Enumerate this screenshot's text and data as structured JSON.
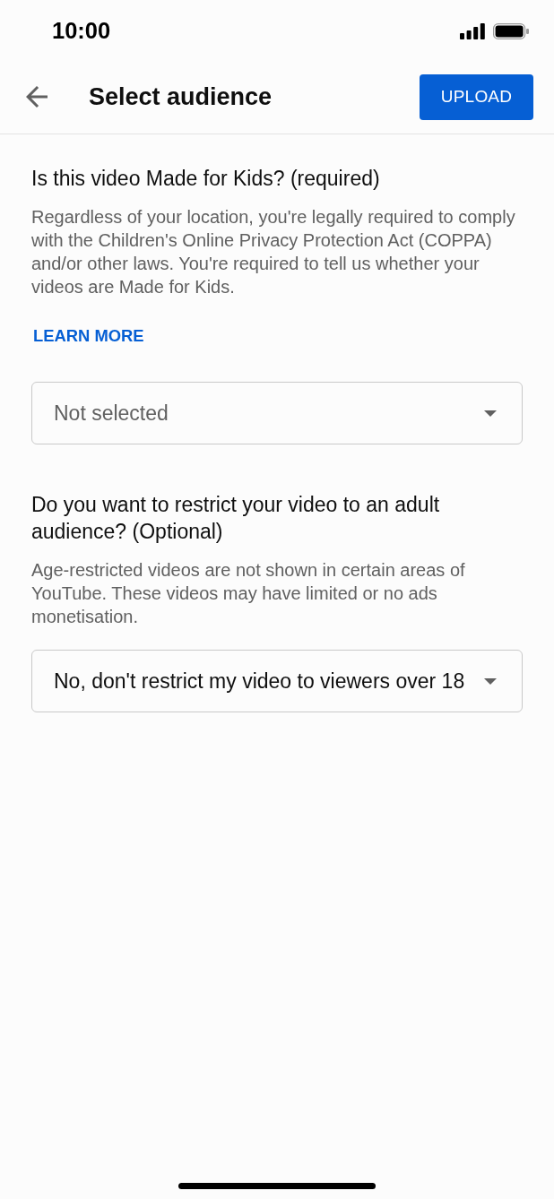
{
  "status_bar": {
    "time": "10:00"
  },
  "header": {
    "title": "Select audience",
    "upload_button": "UPLOAD"
  },
  "sections": [
    {
      "question": "Is this video Made for Kids? (required)",
      "description": "Regardless of your location, you're legally required to comply with the Children's Online Privacy Protection Act (COPPA) and/or other laws. You're required to tell us whether your videos are Made for Kids.",
      "link": "LEARN MORE",
      "dropdown": {
        "placeholder": "Not selected"
      }
    },
    {
      "question": "Do you want to restrict your video to an adult audience? (Optional)",
      "description": "Age-restricted videos are not shown in certain areas of YouTube. These videos may have limited or no ads monetisation.",
      "dropdown": {
        "value": "No, don't restrict my video to viewers over 18"
      }
    }
  ]
}
